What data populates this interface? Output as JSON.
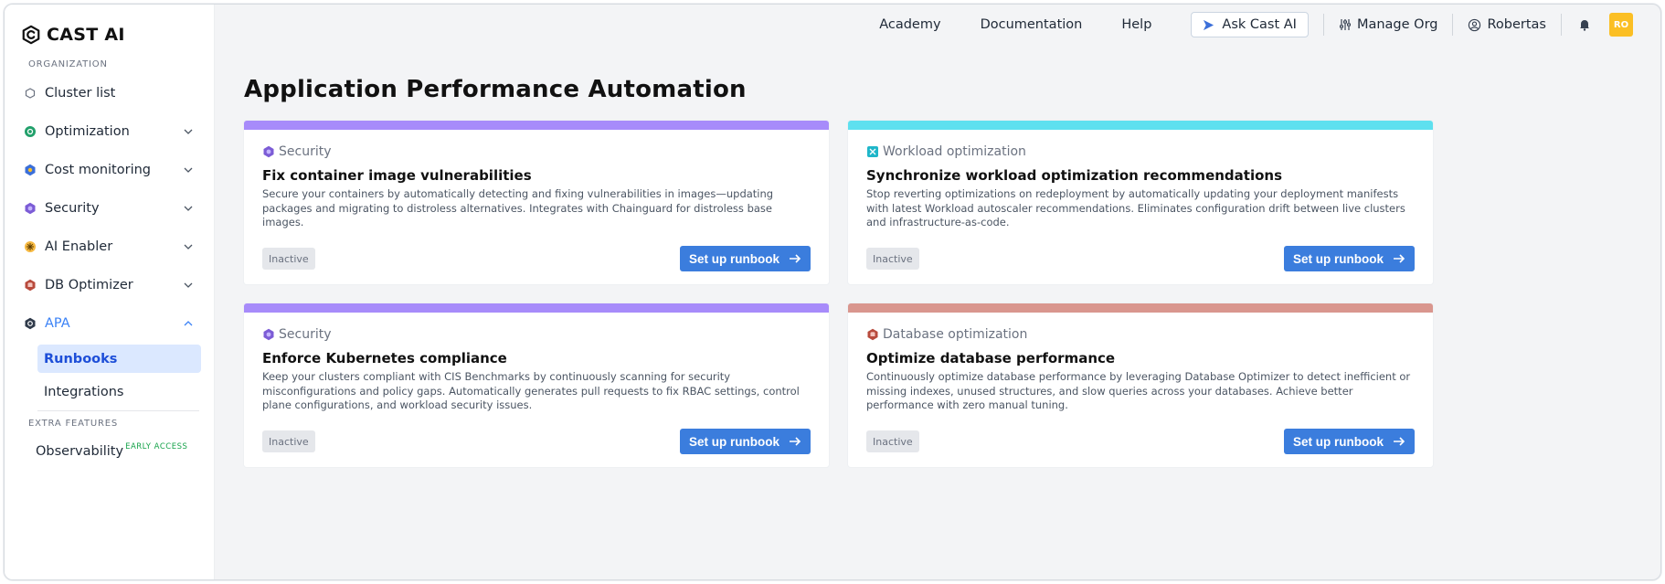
{
  "brand": {
    "name": "CAST AI"
  },
  "sidebar": {
    "section_org": "ORGANIZATION",
    "items": [
      {
        "label": "Cluster list",
        "icon": "hexagon-outline-icon",
        "expandable": false
      },
      {
        "label": "Optimization",
        "icon": "optimization-icon",
        "expandable": true
      },
      {
        "label": "Cost monitoring",
        "icon": "cost-monitoring-icon",
        "expandable": true
      },
      {
        "label": "Security",
        "icon": "security-shield-icon",
        "expandable": true
      },
      {
        "label": "AI Enabler",
        "icon": "ai-enabler-icon",
        "expandable": true
      },
      {
        "label": "DB Optimizer",
        "icon": "db-optimizer-icon",
        "expandable": true
      },
      {
        "label": "APA",
        "icon": "apa-icon",
        "expandable": true,
        "expanded": true
      }
    ],
    "apa_sub": [
      {
        "label": "Runbooks",
        "active": true
      },
      {
        "label": "Integrations",
        "active": false
      }
    ],
    "section_extra": "EXTRA FEATURES",
    "extra": {
      "label": "Observability",
      "badge": "EARLY ACCESS"
    }
  },
  "topbar": {
    "academy": "Academy",
    "documentation": "Documentation",
    "help": "Help",
    "ask": "Ask Cast AI",
    "manage_org": "Manage Org",
    "user": "Robertas",
    "avatar": "RO"
  },
  "page": {
    "title": "Application Performance Automation"
  },
  "colors": {
    "security": "#a78bfa",
    "workload": "#5ee0ef",
    "database": "#d9968e",
    "button": "#3b7ddd",
    "active_nav": "#3b82f6"
  },
  "cards": [
    {
      "category": "Security",
      "title": "Fix container image vulnerabilities",
      "description": "Secure your containers by automatically detecting and fixing vulnerabilities in images—updating packages and migrating to distroless alternatives. Integrates with Chainguard for distroless base images.",
      "status": "Inactive",
      "button": "Set up runbook"
    },
    {
      "category": "Workload optimization",
      "title": "Synchronize workload optimization recommendations",
      "description": "Stop reverting optimizations on redeployment by automatically updating your deployment manifests with latest Workload autoscaler recommendations. Eliminates configuration drift between live clusters and infrastructure-as-code.",
      "status": "Inactive",
      "button": "Set up runbook"
    },
    {
      "category": "Security",
      "title": "Enforce Kubernetes compliance",
      "description": "Keep your clusters compliant with CIS Benchmarks by continuously scanning for security misconfigurations and policy gaps. Automatically generates pull requests to fix RBAC settings, control plane configurations, and workload security issues.",
      "status": "Inactive",
      "button": "Set up runbook"
    },
    {
      "category": "Database optimization",
      "title": "Optimize database performance",
      "description": "Continuously optimize database performance by leveraging Database Optimizer to detect inefficient or missing indexes, unused structures, and slow queries across your databases. Achieve better performance with zero manual tuning.",
      "status": "Inactive",
      "button": "Set up runbook"
    }
  ]
}
